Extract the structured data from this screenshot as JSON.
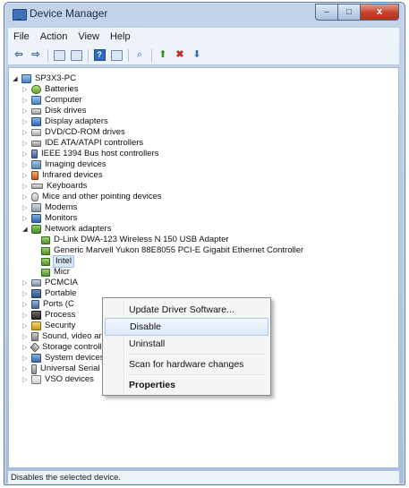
{
  "window": {
    "title": "Device Manager",
    "controls": {
      "minimize": "–",
      "maximize": "□",
      "close": "x"
    }
  },
  "menu": [
    "File",
    "Action",
    "View",
    "Help"
  ],
  "toolbar": [
    "back-arrow-icon",
    "forward-arrow-icon",
    "properties-icon",
    "show-hidden-icon",
    "help-icon",
    "device-view-icon",
    "scan-hardware-icon",
    "update-driver-icon",
    "uninstall-icon",
    "disable-icon"
  ],
  "tree": {
    "root": "SP3X3-PC",
    "items": [
      "Batteries",
      "Computer",
      "Disk drives",
      "Display adapters",
      "DVD/CD-ROM drives",
      "IDE ATA/ATAPI controllers",
      "IEEE 1394 Bus host controllers",
      "Imaging devices",
      "Infrared devices",
      "Keyboards",
      "Mice and other pointing devices",
      "Modems",
      "Monitors",
      "Network adapters"
    ],
    "network_children": [
      "D-Link DWA-123 Wireless N 150 USB Adapter",
      "Generic Marvell Yukon 88E8055 PCI-E Gigabit Ethernet Controller",
      "Intel",
      "Micr"
    ],
    "items_after": [
      "PCMCIA",
      "Portable",
      "Ports (C",
      "Process",
      "Security",
      "Sound, video and game controllers",
      "Storage controllers",
      "System devices",
      "Universal Serial Bus controllers",
      "VSO devices"
    ]
  },
  "context_menu": {
    "items": [
      "Update Driver Software...",
      "Disable",
      "Uninstall",
      "Scan for hardware changes",
      "Properties"
    ]
  },
  "status": "Disables the selected device."
}
